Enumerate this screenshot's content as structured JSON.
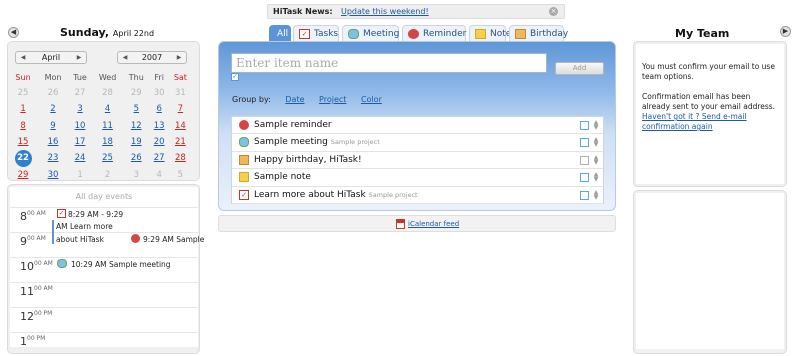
{
  "news": {
    "label": "HiTask News:",
    "link": "Update this weekend!"
  },
  "sidebar": {
    "date_day": "Sunday,",
    "date_rest": "April 22nd",
    "month": "April",
    "year": "2007",
    "weekdays": [
      "Sun",
      "Mon",
      "Tue",
      "Wed",
      "Thu",
      "Fri",
      "Sat"
    ],
    "weeks": [
      [
        "25",
        "26",
        "27",
        "28",
        "29",
        "30",
        "31"
      ],
      [
        "1",
        "2",
        "3",
        "4",
        "5",
        "6",
        "7"
      ],
      [
        "8",
        "9",
        "10",
        "11",
        "12",
        "13",
        "14"
      ],
      [
        "15",
        "16",
        "17",
        "18",
        "19",
        "20",
        "21"
      ],
      [
        "22",
        "23",
        "24",
        "25",
        "26",
        "27",
        "28"
      ],
      [
        "29",
        "30",
        "1",
        "2",
        "3",
        "4",
        "5"
      ]
    ],
    "all_day_label": "All day events",
    "hours": [
      {
        "h": "8",
        "ap": "00 AM"
      },
      {
        "h": "9",
        "ap": "00 AM"
      },
      {
        "h": "10",
        "ap": "00 AM"
      },
      {
        "h": "11",
        "ap": "00 AM"
      },
      {
        "h": "12",
        "ap": "00 PM"
      },
      {
        "h": "1",
        "ap": "00 PM"
      }
    ],
    "events": {
      "ev1_time": "8:29 AM - 9:29",
      "ev1_cont": "AM Learn more",
      "ev1_cont2": "about HiTask",
      "ev2": "9:29 AM Sample",
      "ev3": "10:29 AM Sample meeting"
    }
  },
  "tabs": [
    "All",
    "Tasks",
    "Meeting",
    "Reminder",
    "Note",
    "Birthday"
  ],
  "main": {
    "placeholder": "Enter item name",
    "add_label": "Add",
    "group_by_label": "Group by:",
    "group_by_options": [
      "Date",
      "Project",
      "Color"
    ],
    "items": [
      {
        "title": "Sample reminder",
        "project": "",
        "icon": "reminder-icon"
      },
      {
        "title": "Sample meeting",
        "project": "Sample project",
        "icon": "meeting-icon"
      },
      {
        "title": "Happy birthday, HiTask!",
        "project": "",
        "icon": "birthday-icon"
      },
      {
        "title": "Sample note",
        "project": "",
        "icon": "note-icon"
      },
      {
        "title": "Learn more about HiTask",
        "project": "Sample project",
        "icon": "task-icon"
      }
    ],
    "ical_label": "iCalendar feed"
  },
  "team": {
    "title": "My Team",
    "msg1": "You must confirm your email to use team options.",
    "msg2": "Confirmation email has been already sent to your email address.",
    "link": "Haven't got it ? Send e-mail confirmation again"
  },
  "colors": {
    "accent": "#5b95d8",
    "link": "#1a5aa8",
    "weekend": "#cc2222",
    "today": "#2f80d0"
  }
}
